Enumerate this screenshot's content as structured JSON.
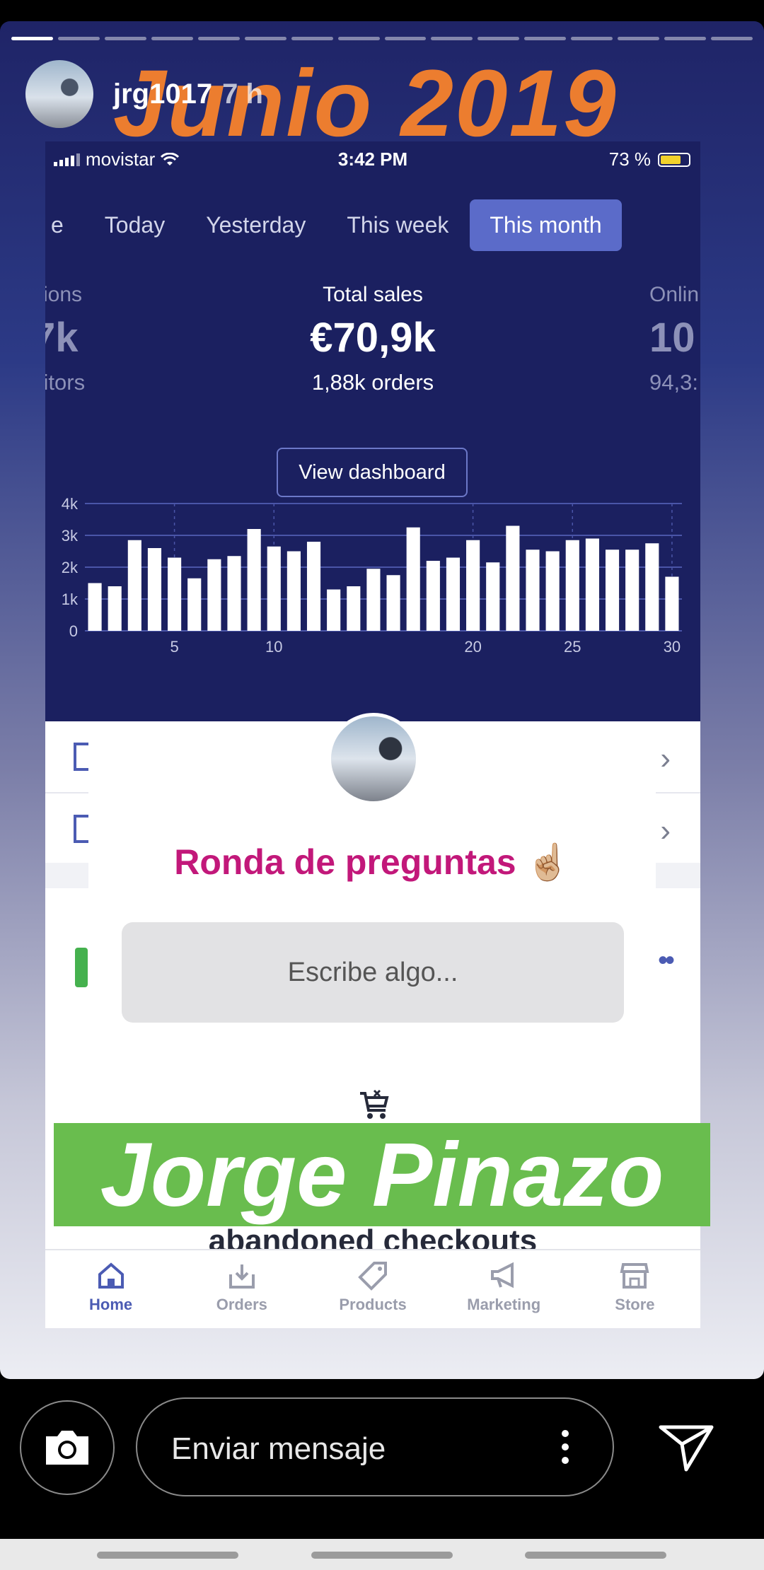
{
  "story": {
    "username": "jrg1017",
    "time": "7 h",
    "headline": "Junio 2019",
    "progress_total": 16,
    "progress_done": 1
  },
  "statusbar": {
    "carrier": "movistar",
    "clock": "3:42 PM",
    "battery": "73 %",
    "battery_level": 0.73
  },
  "tabs": [
    {
      "label": "e"
    },
    {
      "label": "Today"
    },
    {
      "label": "Yesterday"
    },
    {
      "label": "This week"
    },
    {
      "label": "This month",
      "active": true
    }
  ],
  "metrics": {
    "left": {
      "label": "sions",
      "value": "7k",
      "sub": "sitors"
    },
    "center": {
      "label": "Total sales",
      "value": "€70,9k",
      "sub": "1,88k orders"
    },
    "right": {
      "label": "Onlin",
      "value": "10",
      "sub": "94,3:"
    }
  },
  "view_dashboard": "View dashboard",
  "chart_data": {
    "type": "bar",
    "x": [
      1,
      2,
      3,
      4,
      5,
      6,
      7,
      8,
      9,
      10,
      11,
      12,
      13,
      14,
      15,
      16,
      17,
      18,
      19,
      20,
      21,
      22,
      23,
      24,
      25,
      26,
      27,
      28,
      29,
      30
    ],
    "values": [
      1500,
      1400,
      2850,
      2600,
      2300,
      1650,
      2250,
      2350,
      3200,
      2650,
      2500,
      2800,
      1300,
      1400,
      1950,
      1750,
      3250,
      2200,
      2300,
      2850,
      2150,
      3300,
      2550,
      2500,
      2850,
      2900,
      2550,
      2550,
      2750,
      1700
    ],
    "y_ticks": [
      "0",
      "1k",
      "2k",
      "3k",
      "4k"
    ],
    "x_ticks": [
      "5",
      "10",
      "20",
      "25",
      "30"
    ],
    "ylim": [
      0,
      4000
    ],
    "bar_color": "#ffffff",
    "grid_color": "#4a55a8"
  },
  "quiz": {
    "title": "Ronda de preguntas ☝🏼",
    "placeholder": "Escribe algo..."
  },
  "banner": {
    "name": "Jorge Pinazo"
  },
  "abandoned_text": "abandoned checkouts",
  "nav": [
    {
      "label": "Home",
      "icon": "home-icon",
      "active": true
    },
    {
      "label": "Orders",
      "icon": "orders-icon"
    },
    {
      "label": "Products",
      "icon": "tag-icon"
    },
    {
      "label": "Marketing",
      "icon": "megaphone-icon"
    },
    {
      "label": "Store",
      "icon": "store-icon"
    }
  ],
  "composer": {
    "placeholder": "Enviar mensaje"
  }
}
